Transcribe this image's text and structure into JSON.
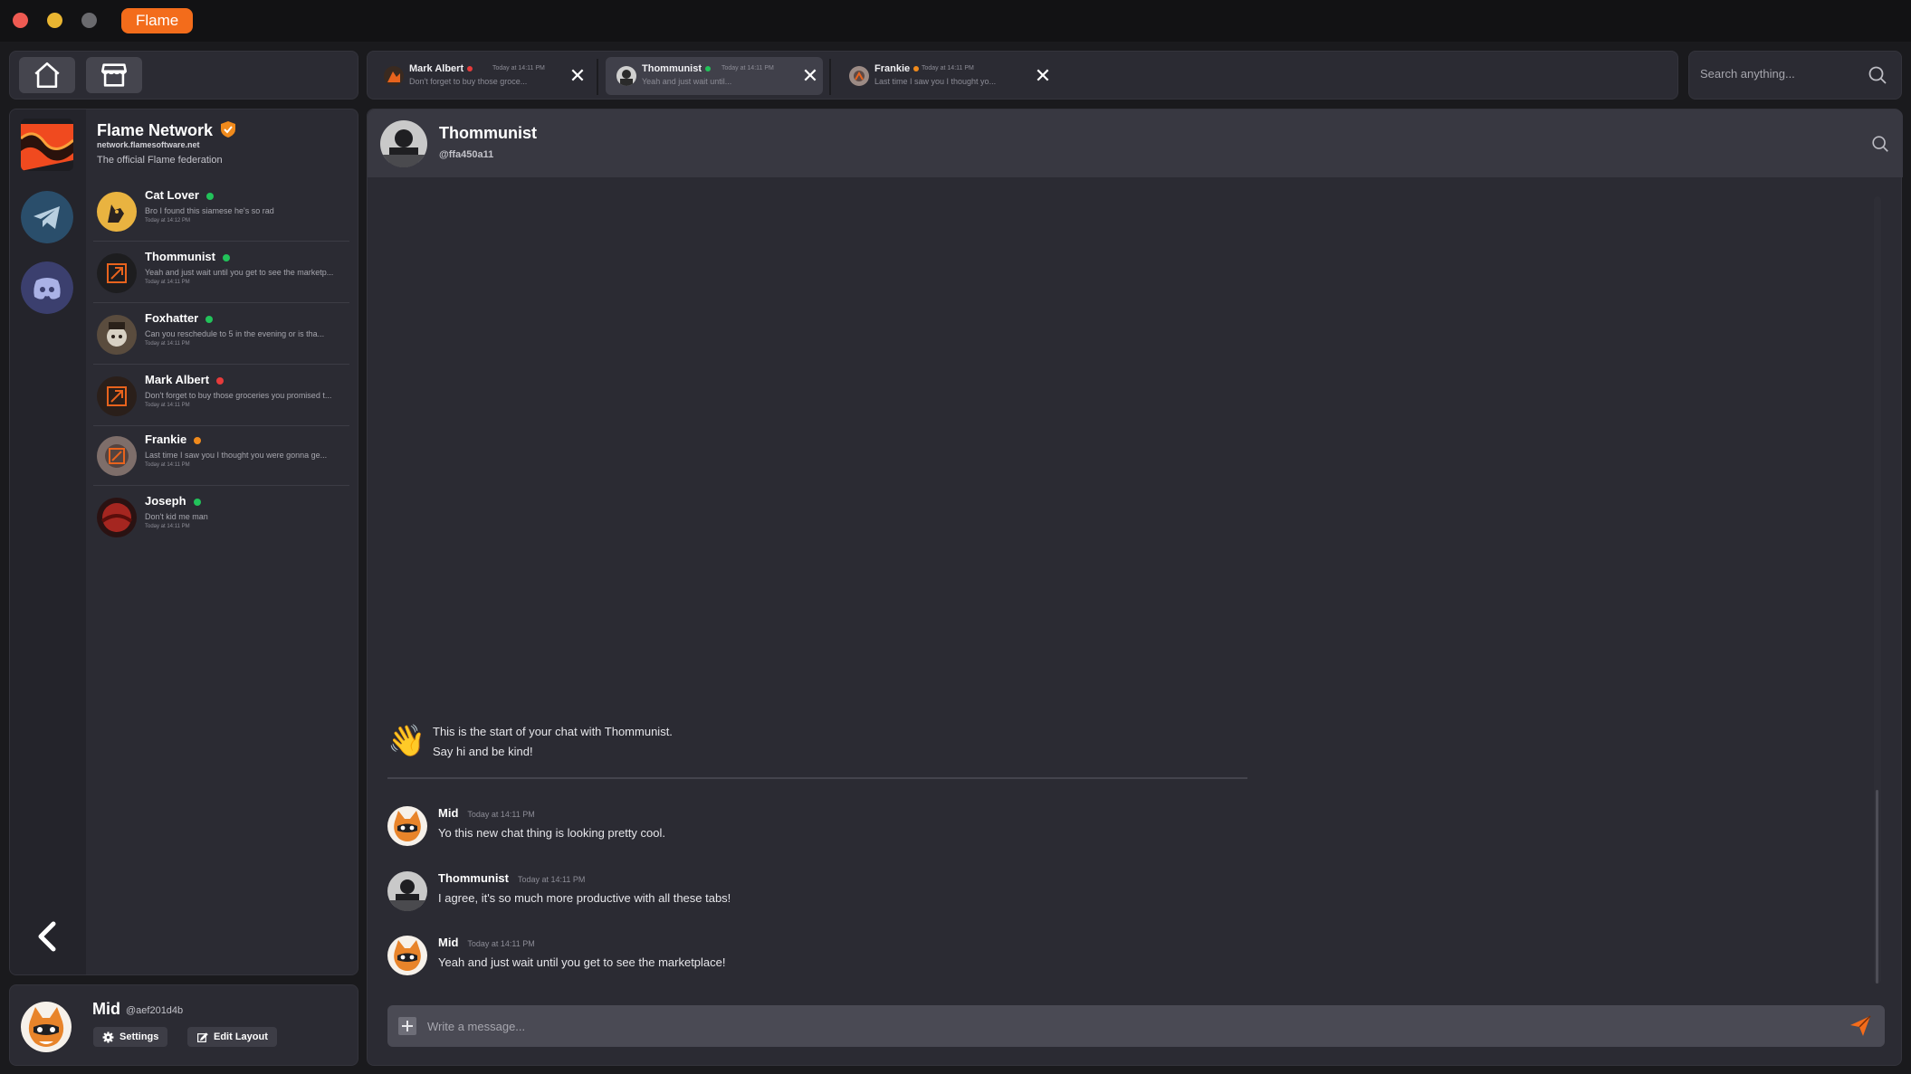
{
  "window": {
    "app_name": "Flame"
  },
  "colors": {
    "accent": "#f36c1b",
    "online": "#22c25a",
    "busy": "#e63b3b",
    "away": "#f08a1c"
  },
  "nav": {
    "home_icon": "home-icon",
    "store_icon": "store-icon"
  },
  "tabs": [
    {
      "name": "Mark Albert",
      "status": "busy",
      "time": "Today at 14:11 PM",
      "preview": "Don't forget to buy those groce..."
    },
    {
      "name": "Thommunist",
      "status": "online",
      "time": "Today at 14:11 PM",
      "preview": "Yeah and just wait until..."
    },
    {
      "name": "Frankie",
      "status": "away",
      "time": "Today at 14:11 PM",
      "preview": "Last time I saw you I thought yo..."
    }
  ],
  "search": {
    "placeholder": "Search anything..."
  },
  "network": {
    "name": "Flame Network",
    "url": "network.flamesoftware.net",
    "description": "The official Flame federation"
  },
  "contacts": [
    {
      "name": "Cat Lover",
      "status": "online",
      "message": "Bro I found this siamese he's so rad",
      "time": "Today at 14:12 PM"
    },
    {
      "name": "Thommunist",
      "status": "online",
      "message": "Yeah and just wait until you get to see the marketp...",
      "time": "Today at 14:11 PM"
    },
    {
      "name": "Foxhatter",
      "status": "online",
      "message": "Can you reschedule to 5 in the evening or is tha...",
      "time": "Today at 14:11 PM"
    },
    {
      "name": "Mark Albert",
      "status": "busy",
      "message": "Don't forget to buy those groceries you promised t...",
      "time": "Today at 14:11 PM"
    },
    {
      "name": "Frankie",
      "status": "away",
      "message": "Last time I saw you I thought you were gonna ge...",
      "time": "Today at 14:11 PM"
    },
    {
      "name": "Joseph",
      "status": "online",
      "message": "Don't kid me man",
      "time": "Today at 14:11 PM"
    }
  ],
  "profile": {
    "name": "Mid",
    "handle": "@aef201d4b",
    "settings_label": "Settings",
    "edit_layout_label": "Edit Layout"
  },
  "chat": {
    "name": "Thommunist",
    "handle": "@ffa450a11",
    "start_line1": "This is the start of your chat with Thommunist.",
    "start_line2": "Say hi and be kind!",
    "messages": [
      {
        "author": "Mid",
        "time": "Today at 14:11 PM",
        "text": "Yo this new chat thing is looking pretty cool."
      },
      {
        "author": "Thommunist",
        "time": "Today at 14:11 PM",
        "text": "I agree, it's so much more productive with all these tabs!"
      },
      {
        "author": "Mid",
        "time": "Today at 14:11 PM",
        "text": "Yeah and just wait until you get to see the marketplace!"
      }
    ],
    "composer_placeholder": "Write a message..."
  }
}
